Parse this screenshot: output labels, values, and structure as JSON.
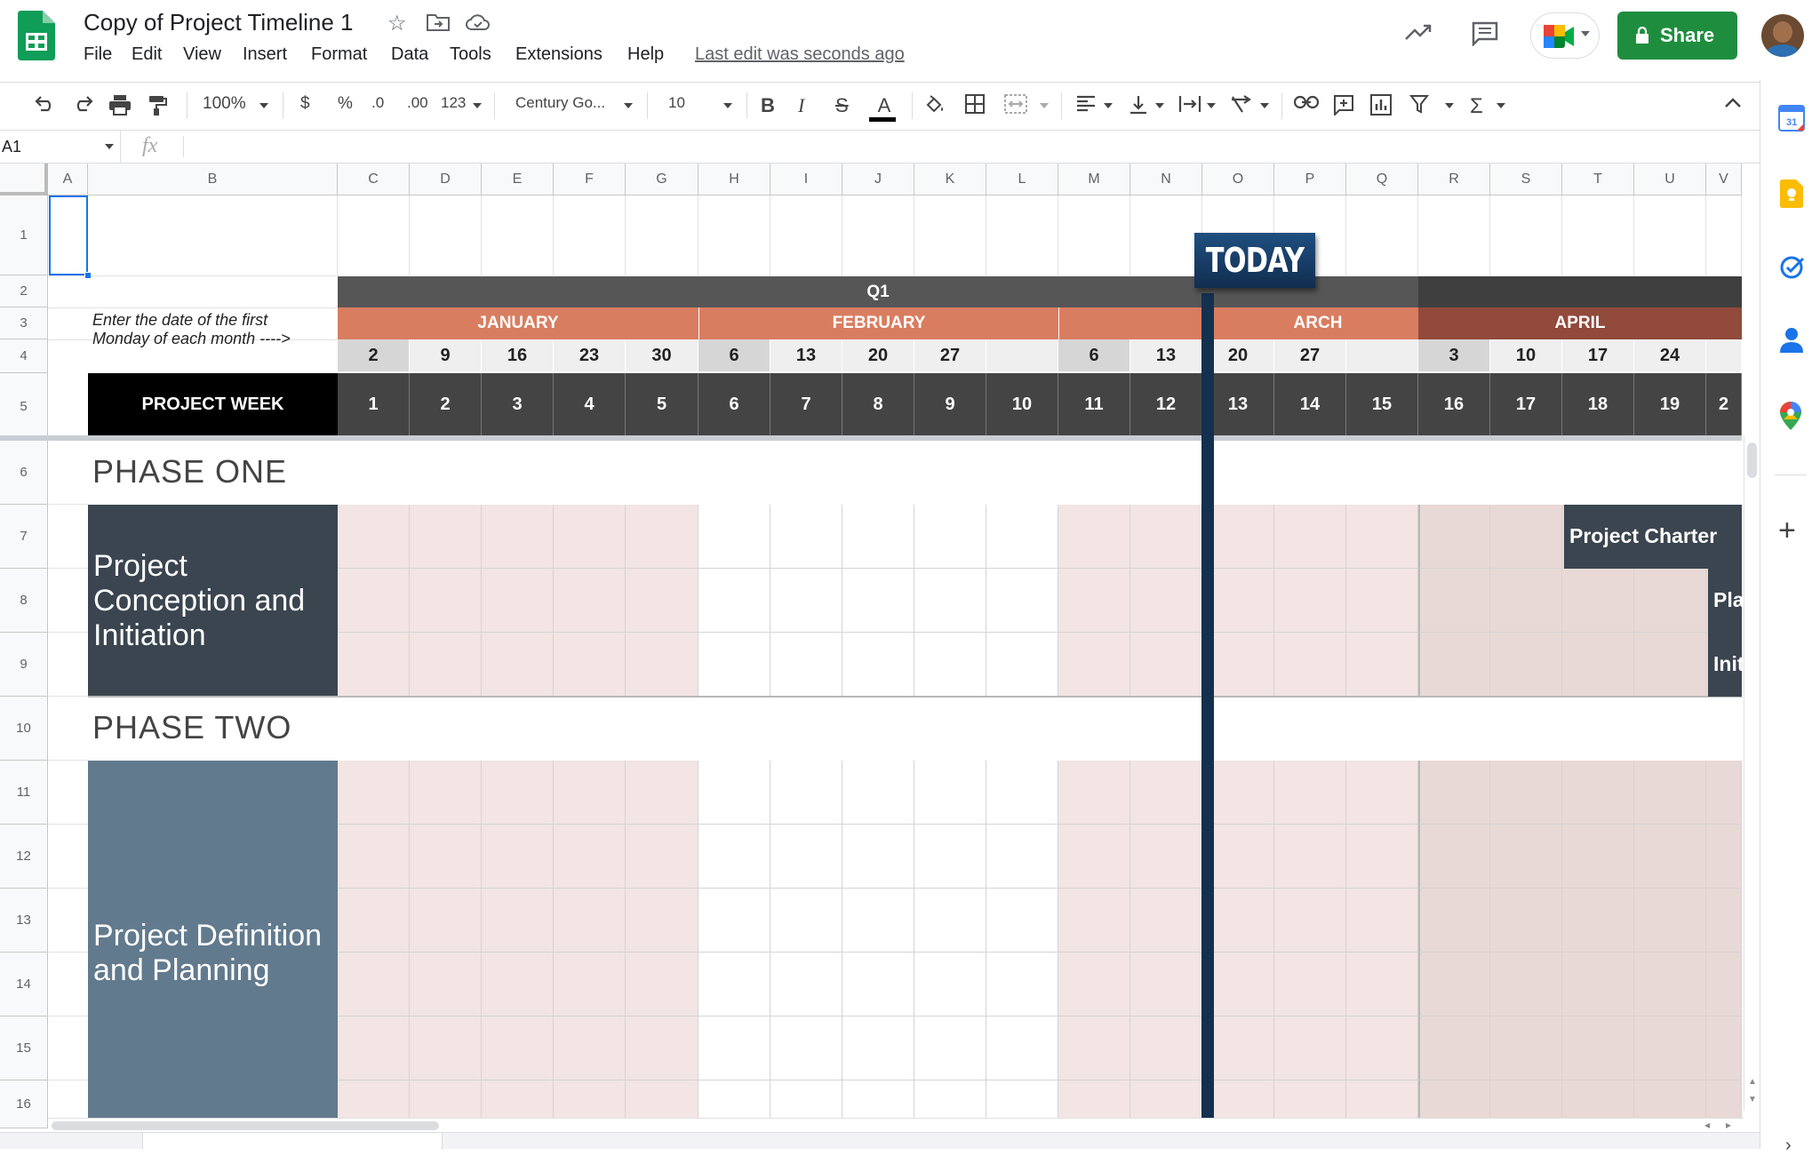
{
  "app": {
    "doc_title": "Copy of Project Timeline 1",
    "last_edit": "Last edit was seconds ago",
    "share_label": "Share",
    "menu": [
      "File",
      "Edit",
      "View",
      "Insert",
      "Format",
      "Data",
      "Tools",
      "Extensions",
      "Help"
    ]
  },
  "toolbar": {
    "zoom": "100%",
    "currency": "$",
    "percent": "%",
    "dec_decrease": ".0",
    "dec_increase": ".00",
    "number_format": "123",
    "font": "Century Go...",
    "font_size": "10"
  },
  "formula_bar": {
    "cell_ref": "A1",
    "fx": "fx",
    "value": ""
  },
  "grid": {
    "columns": [
      "A",
      "B",
      "C",
      "D",
      "E",
      "F",
      "G",
      "H",
      "I",
      "J",
      "K",
      "L",
      "M",
      "N",
      "O",
      "P",
      "Q",
      "R",
      "S",
      "T",
      "U",
      "V"
    ],
    "rows": [
      "1",
      "2",
      "3",
      "4",
      "5",
      "6",
      "7",
      "8",
      "9",
      "10",
      "11",
      "12",
      "13",
      "14",
      "15",
      "16"
    ]
  },
  "sheet": {
    "quarter": "Q1",
    "months": [
      "JANUARY",
      "FEBRUARY",
      "ARCH",
      "APRIL"
    ],
    "dates": [
      "2",
      "9",
      "16",
      "23",
      "30",
      "6",
      "13",
      "20",
      "27",
      "",
      "6",
      "13",
      "20",
      "27",
      "",
      "3",
      "10",
      "17",
      "24"
    ],
    "instruction": "Enter the date of the first Monday of each month ---->",
    "project_week_label": "PROJECT WEEK",
    "weeks": [
      "1",
      "2",
      "3",
      "4",
      "5",
      "6",
      "7",
      "8",
      "9",
      "10",
      "11",
      "12",
      "13",
      "14",
      "15",
      "16",
      "17",
      "18",
      "19",
      "2"
    ],
    "today_label": "TODAY",
    "phase_one": "PHASE ONE",
    "phase_one_block": "Project Conception and Initiation",
    "phase_two": "PHASE TWO",
    "phase_two_block": "Project Definition and Planning",
    "tasks": [
      "Project Charter",
      "Pla",
      "Init"
    ]
  },
  "colors": {
    "share_green": "#1e8e3e",
    "month_salmon": "#d97d60",
    "april_red": "#914a3c",
    "today_navy": "#14304f"
  }
}
